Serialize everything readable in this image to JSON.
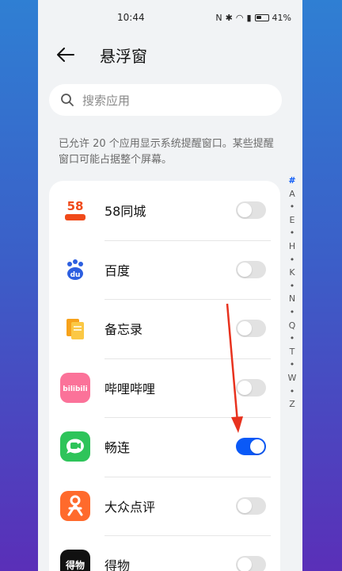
{
  "status_bar": {
    "time": "10:44",
    "battery": "41%"
  },
  "header": {
    "title": "悬浮窗"
  },
  "search": {
    "placeholder": "搜索应用"
  },
  "notice": "已允许 20 个应用显示系统提醒窗口。某些提醒窗口可能占据整个屏幕。",
  "apps": [
    {
      "name": "58同城",
      "icon": "58-tongcheng-icon",
      "enabled": false
    },
    {
      "name": "百度",
      "icon": "baidu-icon",
      "enabled": false
    },
    {
      "name": "备忘录",
      "icon": "notes-icon",
      "enabled": false
    },
    {
      "name": "哔哩哔哩",
      "icon": "bilibili-icon",
      "enabled": false
    },
    {
      "name": "畅连",
      "icon": "changlian-icon",
      "enabled": true
    },
    {
      "name": "大众点评",
      "icon": "dianping-icon",
      "enabled": false
    },
    {
      "name": "得物",
      "icon": "dewu-icon",
      "enabled": false
    }
  ],
  "index_letters": [
    "#",
    "A",
    "•",
    "E",
    "•",
    "H",
    "•",
    "K",
    "•",
    "N",
    "•",
    "Q",
    "•",
    "T",
    "•",
    "W",
    "•",
    "Z"
  ],
  "icon_labels": {
    "58": "58",
    "du": "du",
    "bili": "bilibili",
    "dewu": "得物"
  },
  "colors": {
    "accent": "#0a59f7",
    "annotation_arrow": "#e8321e"
  }
}
